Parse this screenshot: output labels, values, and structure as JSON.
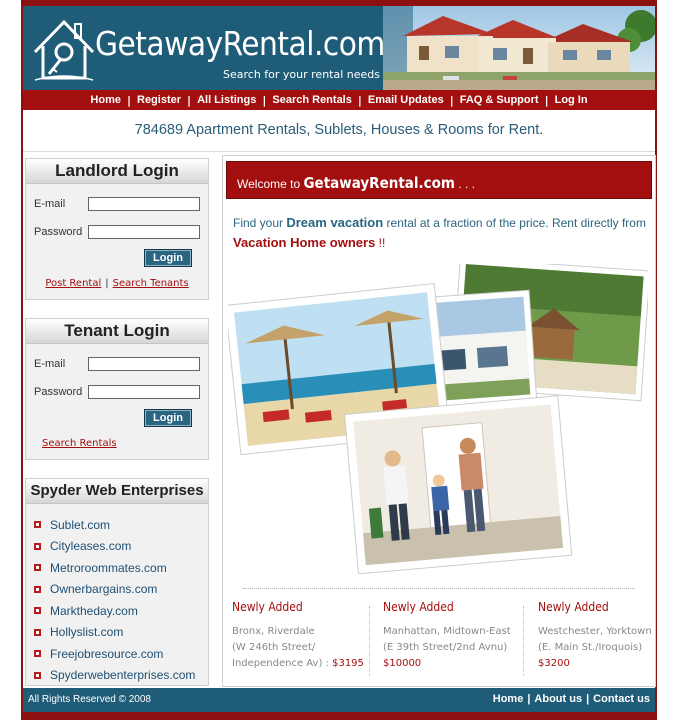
{
  "header": {
    "logo_text": "GetawayRental.com",
    "tagline": "Search for your rental needs"
  },
  "nav": {
    "items": [
      "Home",
      "Register",
      "All Listings",
      "Search Rentals",
      "Email Updates",
      "FAQ & Support",
      "Log In"
    ]
  },
  "listing_count": "784689  Apartment Rentals, Sublets, Houses & Rooms for Rent.",
  "landlord_login": {
    "title": "Landlord Login",
    "email_label": "E-mail",
    "password_label": "Password",
    "button": "Login",
    "link_post": "Post Rental",
    "link_search": "Search Tenants",
    "separator": "|"
  },
  "tenant_login": {
    "title": "Tenant Login",
    "email_label": "E-mail",
    "password_label": "Password",
    "button": "Login",
    "link_search": "Search Rentals"
  },
  "network": {
    "title": "Spyder Web Enterprises",
    "sites": [
      "Sublet.com",
      "Cityleases.com",
      "Metroroommates.com",
      "Ownerbargains.com",
      "Marktheday.com",
      "Hollyslist.com",
      "Freejobresource.com",
      "Spyderwebenterprises.com"
    ]
  },
  "welcome": {
    "prefix": "Welcome to",
    "brand": "GetawayRental.com",
    "suffix": ". . ."
  },
  "promo": {
    "part1": "Find your ",
    "dream": "Dream vacation",
    "part2": " rental at a fraction of the price. Rent directly from ",
    "owners": "Vacation Home owners",
    "bang": " !!"
  },
  "newly_added": [
    {
      "title": "Newly Added",
      "loc1": "Bronx, Riverdale",
      "loc2": "(W 246th Street/",
      "loc3": "Independence Av) : ",
      "price": "$3195"
    },
    {
      "title": "Newly Added",
      "loc1": "Manhattan, Midtown-East",
      "loc2": "(E 39th Street/2nd Avnu)",
      "loc3": "",
      "price": "$10000"
    },
    {
      "title": "Newly Added",
      "loc1": "Westchester, Yorktown",
      "loc2": "(E. Main St./Iroquois)",
      "loc3": "",
      "price": "$3200"
    }
  ],
  "footer": {
    "copyright": "All Rights Reserved © 2008",
    "links": [
      "Home",
      "About us",
      "Contact us"
    ],
    "separator": "|"
  },
  "colors": {
    "brand_red": "#a30f0f",
    "brand_blue": "#1f5c78",
    "link_blue": "#1f4f73"
  }
}
